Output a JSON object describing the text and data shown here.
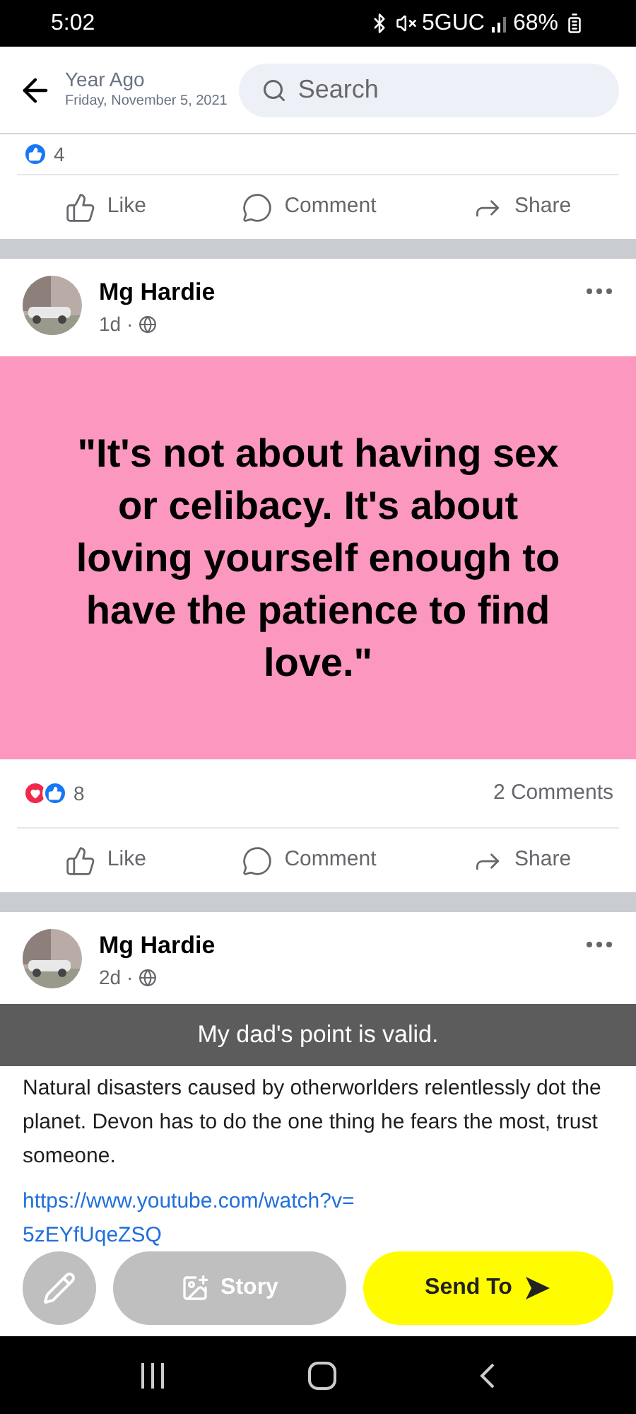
{
  "status_bar": {
    "time": "5:02",
    "network": "5GUC",
    "battery": "68%"
  },
  "header": {
    "title": "Year Ago",
    "date": "Friday, November 5, 2021",
    "search": {
      "placeholder": "Search"
    }
  },
  "posts": [
    {
      "reactions": {
        "count": "4",
        "icons": [
          {
            "kind": "like"
          }
        ]
      },
      "actions": [
        "Like",
        "Comment",
        "Share"
      ]
    },
    {
      "author": "Mg Hardie",
      "time": "1d ·",
      "quote": "\"It's not about having sex or celibacy. It's about loving yourself enough to have the patience to find love.\"",
      "reactions": {
        "count": "8",
        "icons": [
          {
            "kind": "love"
          },
          {
            "kind": "like"
          }
        ]
      },
      "comments": "2 Comments",
      "actions": [
        "Like",
        "Comment",
        "Share"
      ]
    },
    {
      "author": "Mg Hardie",
      "time": "2d ·",
      "text": "Natural disasters caused by otherworlders relentlessly dot the planet. Devon has to do the one thing he fears the most, trust someone.",
      "link": "https://www.youtube.com/watch?v= 5zEYfUqeZSQ"
    }
  ],
  "caption": "My dad's point is valid.",
  "snap_controls": {
    "story": "Story",
    "send": "Send To"
  }
}
